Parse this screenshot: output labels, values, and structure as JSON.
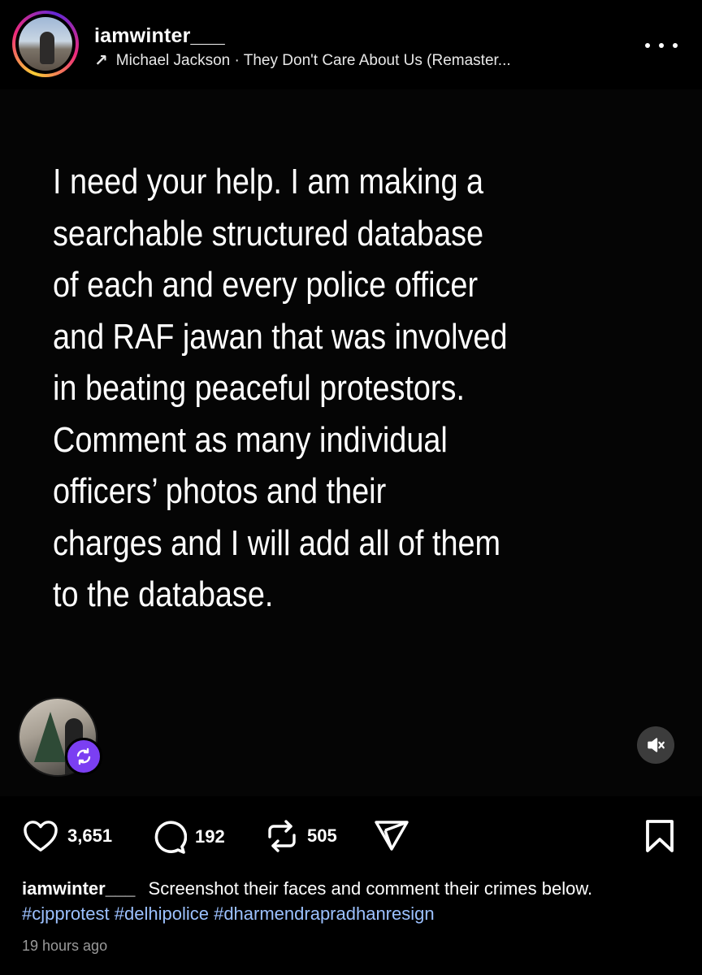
{
  "header": {
    "username": "iamwinter___",
    "music": "Michael Jackson · They Don't Care About Us (Remaster...",
    "music_arrow": "↗"
  },
  "post": {
    "lines": [
      "I need your help. I am making a",
      "searchable structured database",
      "of each and every police officer",
      "and RAF jawan that was involved",
      "in beating peaceful protestors.",
      "Comment as many individual",
      "officers’ photos and their",
      "charges and I will add all of them",
      "to the database."
    ]
  },
  "actions": {
    "likes": "3,651",
    "comments": "192",
    "reposts": "505"
  },
  "caption": {
    "username": "iamwinter___",
    "text": "Screenshot their faces and comment their crimes below.",
    "hashtags": [
      "#cjpprotest",
      "#delhipolice",
      "#dharmendrapradhanresign"
    ]
  },
  "timestamp": "19 hours ago",
  "colors": {
    "background": "#000000",
    "hashtag": "#9cc1ff",
    "remix_badge": "#7b3ff2",
    "muted_text": "#9a9a9a"
  }
}
